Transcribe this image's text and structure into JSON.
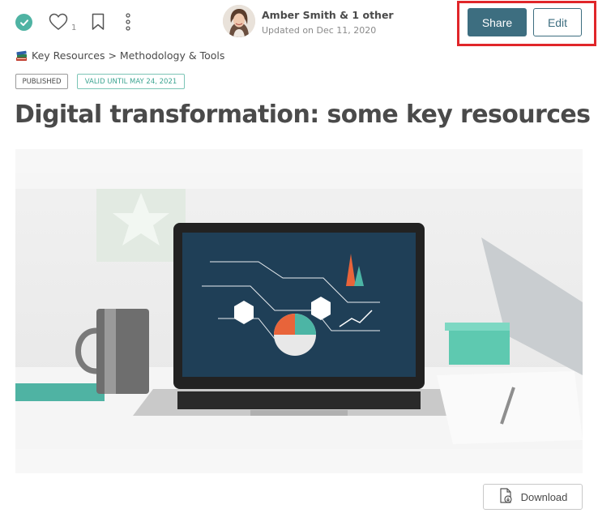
{
  "toolbar": {
    "like_count": "1",
    "status_color": "#4fb3a3"
  },
  "author": {
    "name": "Amber Smith & 1 other",
    "updated": "Updated on Dec 11, 2020"
  },
  "actions": {
    "share_label": "Share",
    "edit_label": "Edit",
    "download_label": "Download",
    "accent": "#3d6e80"
  },
  "breadcrumb": {
    "icon": "books-icon",
    "path": "Key Resources > Methodology & Tools"
  },
  "badges": {
    "published": "PUBLISHED",
    "valid": "VALID UNTIL MAY 24, 2021"
  },
  "article": {
    "title": "Digital transformation: some key resources",
    "title_icon": "books-icon"
  }
}
